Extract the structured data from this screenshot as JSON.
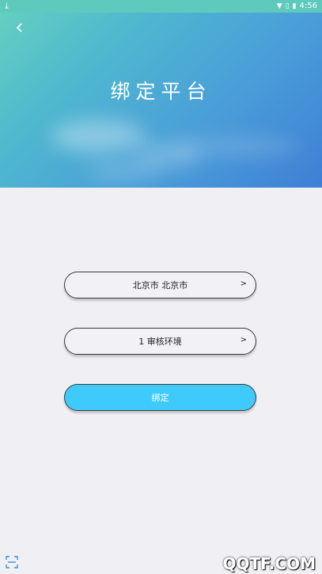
{
  "status_bar": {
    "time": "4:56",
    "icons": [
      "download-icon",
      "wifi-icon",
      "signal-icon",
      "battery-icon"
    ]
  },
  "header": {
    "title": "绑定平台",
    "back_icon": "chevron-left-icon"
  },
  "form": {
    "region": {
      "value": "北京市 北京市",
      "chevron": ">"
    },
    "environment": {
      "value": "1 审核环境",
      "chevron": ">"
    },
    "bind_label": "绑定"
  },
  "watermark": "QQTF.COM",
  "colors": {
    "status_bar": "#5ec9bd",
    "button": "#3ecbfb",
    "background": "#f0f0f4"
  }
}
